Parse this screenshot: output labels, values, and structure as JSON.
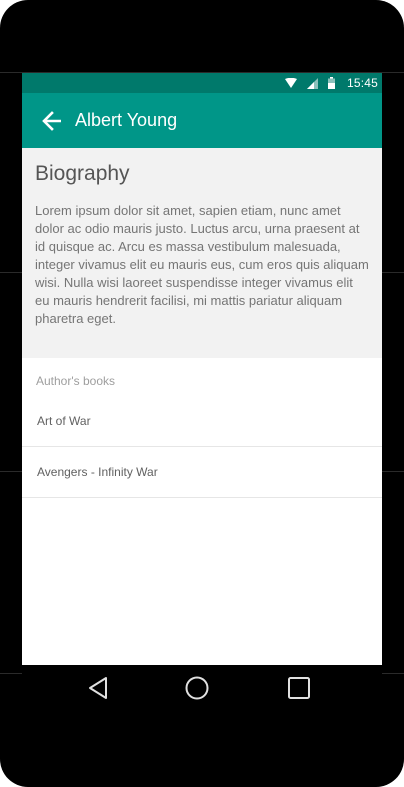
{
  "status_bar": {
    "time": "15:45",
    "icons": [
      "wifi-icon",
      "signal-icon",
      "battery-icon"
    ],
    "background": "#00796b"
  },
  "app_bar": {
    "title": "Albert Young",
    "back_icon": "arrow-back-icon",
    "background": "#009688"
  },
  "biography": {
    "heading": "Biography",
    "text": "Lorem ipsum dolor sit amet, sapien etiam, nunc amet dolor ac odio mauris justo. Luctus arcu, urna praesent at id quisque ac. Arcu es massa vestibulum malesuada, integer vivamus elit eu mauris eus, cum eros quis aliquam wisi. Nulla wisi laoreet suspendisse integer vivamus elit eu mauris hendrerit facilisi, mi mattis pariatur aliquam pharetra eget."
  },
  "books": {
    "subheader": "Author's books",
    "items": [
      {
        "title": "Art of War"
      },
      {
        "title": "Avengers - Infinity War"
      }
    ]
  },
  "nav_bar": {
    "buttons": [
      "back-triangle-icon",
      "home-circle-icon",
      "recents-square-icon"
    ]
  }
}
